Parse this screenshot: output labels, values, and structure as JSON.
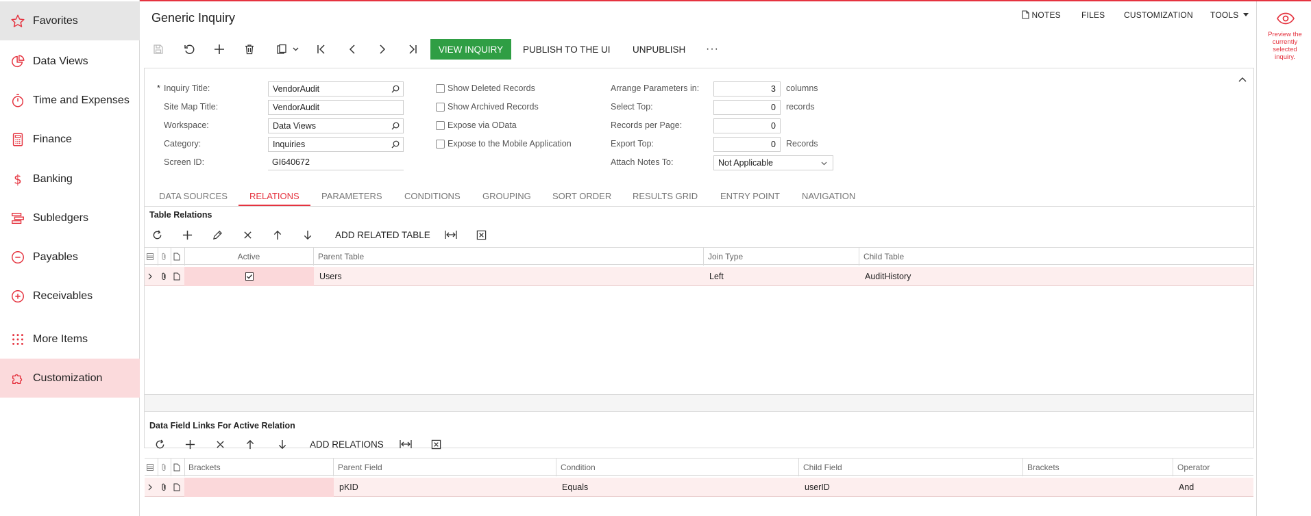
{
  "sidebar": {
    "items": [
      {
        "label": "Favorites",
        "icon": "star-icon"
      },
      {
        "label": "Data Views",
        "icon": "pie-chart-icon"
      },
      {
        "label": "Time and Expenses",
        "icon": "stopwatch-icon"
      },
      {
        "label": "Finance",
        "icon": "calculator-icon"
      },
      {
        "label": "Banking",
        "icon": "dollar-icon"
      },
      {
        "label": "Subledgers",
        "icon": "subledgers-icon"
      },
      {
        "label": "Payables",
        "icon": "minus-circle-icon"
      },
      {
        "label": "Receivables",
        "icon": "plus-circle-icon"
      },
      {
        "label": "More Items",
        "icon": "dots-grid-icon"
      },
      {
        "label": "Customization",
        "icon": "puzzle-icon"
      }
    ]
  },
  "header": {
    "title": "Generic Inquiry",
    "links": {
      "notes": "NOTES",
      "files": "FILES",
      "customization": "CUSTOMIZATION",
      "tools": "TOOLS"
    }
  },
  "preview": {
    "text": "Preview the currently selected inquiry."
  },
  "toolbar": {
    "view_inquiry": "VIEW INQUIRY",
    "publish": "PUBLISH TO THE UI",
    "unpublish": "UNPUBLISH",
    "more": "···"
  },
  "form": {
    "inquiry_title_label": "Inquiry Title:",
    "inquiry_title_value": "VendorAudit",
    "site_map_title_label": "Site Map Title:",
    "site_map_title_value": "VendorAudit",
    "workspace_label": "Workspace:",
    "workspace_value": "Data Views",
    "category_label": "Category:",
    "category_value": "Inquiries",
    "screen_id_label": "Screen ID:",
    "screen_id_value": "GI640672",
    "show_deleted_label": "Show Deleted Records",
    "show_archived_label": "Show Archived Records",
    "expose_odata_label": "Expose via OData",
    "expose_mobile_label": "Expose to the Mobile Application",
    "arrange_label": "Arrange Parameters in:",
    "arrange_value": "3",
    "arrange_suffix": "columns",
    "select_top_label": "Select Top:",
    "select_top_value": "0",
    "select_top_suffix": "records",
    "records_per_page_label": "Records per Page:",
    "records_per_page_value": "0",
    "export_top_label": "Export Top:",
    "export_top_value": "0",
    "export_top_suffix": "Records",
    "attach_notes_label": "Attach Notes To:",
    "attach_notes_value": "Not Applicable"
  },
  "tabs": [
    "DATA SOURCES",
    "RELATIONS",
    "PARAMETERS",
    "CONDITIONS",
    "GROUPING",
    "SORT ORDER",
    "RESULTS GRID",
    "ENTRY POINT",
    "NAVIGATION"
  ],
  "relations": {
    "title": "Table Relations",
    "add_related_table": "ADD RELATED TABLE",
    "columns": {
      "active": "Active",
      "parent_table": "Parent Table",
      "join_type": "Join Type",
      "child_table": "Child Table"
    },
    "rows": [
      {
        "active": true,
        "parent_table": "Users",
        "join_type": "Left",
        "child_table": "AuditHistory"
      }
    ]
  },
  "links": {
    "title": "Data Field Links For Active Relation",
    "add_relations": "ADD RELATIONS",
    "columns": {
      "brackets": "Brackets",
      "parent_field": "Parent Field",
      "condition": "Condition",
      "child_field": "Child Field",
      "brackets2": "Brackets",
      "operator": "Operator"
    },
    "rows": [
      {
        "brackets": "",
        "parent_field": "pKID",
        "condition": "Equals",
        "child_field": "userID",
        "brackets2": "",
        "operator": "And"
      }
    ]
  },
  "colors": {
    "accent": "#e5333f",
    "green": "#2f9e44",
    "row_highlight": "#fdeeee"
  }
}
